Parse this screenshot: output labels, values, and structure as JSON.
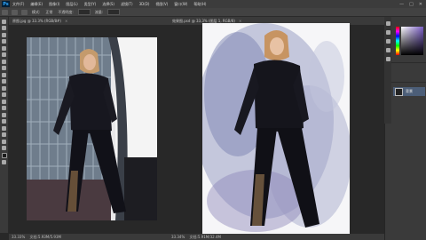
{
  "app": {
    "logo": "Ps"
  },
  "menu": {
    "items": [
      "文件(F)",
      "编辑(E)",
      "图像(I)",
      "图层(L)",
      "类型(Y)",
      "选择(S)",
      "滤镜(T)",
      "3D(D)",
      "视图(V)",
      "窗口(W)",
      "帮助(H)"
    ]
  },
  "window_controls": [
    "—",
    "□",
    "✕"
  ],
  "options_bar": {
    "mode_label": "模式:",
    "mode_value": "正常",
    "opacity_label": "不透明度:",
    "flow_label": "流量:"
  },
  "documents": {
    "left": {
      "tab": "原图.jpg @ 33.3% (RGB/8#)",
      "status_zoom": "33.33%",
      "status_doc": "文档:5.93M/5.93M"
    },
    "right": {
      "tab": "效果图.psd @ 33.3% (图层 1, RGB/8)",
      "status_zoom": "33.34%",
      "status_doc": "文档:5.91M/32.4M"
    }
  },
  "layers": {
    "selected": "背景"
  }
}
